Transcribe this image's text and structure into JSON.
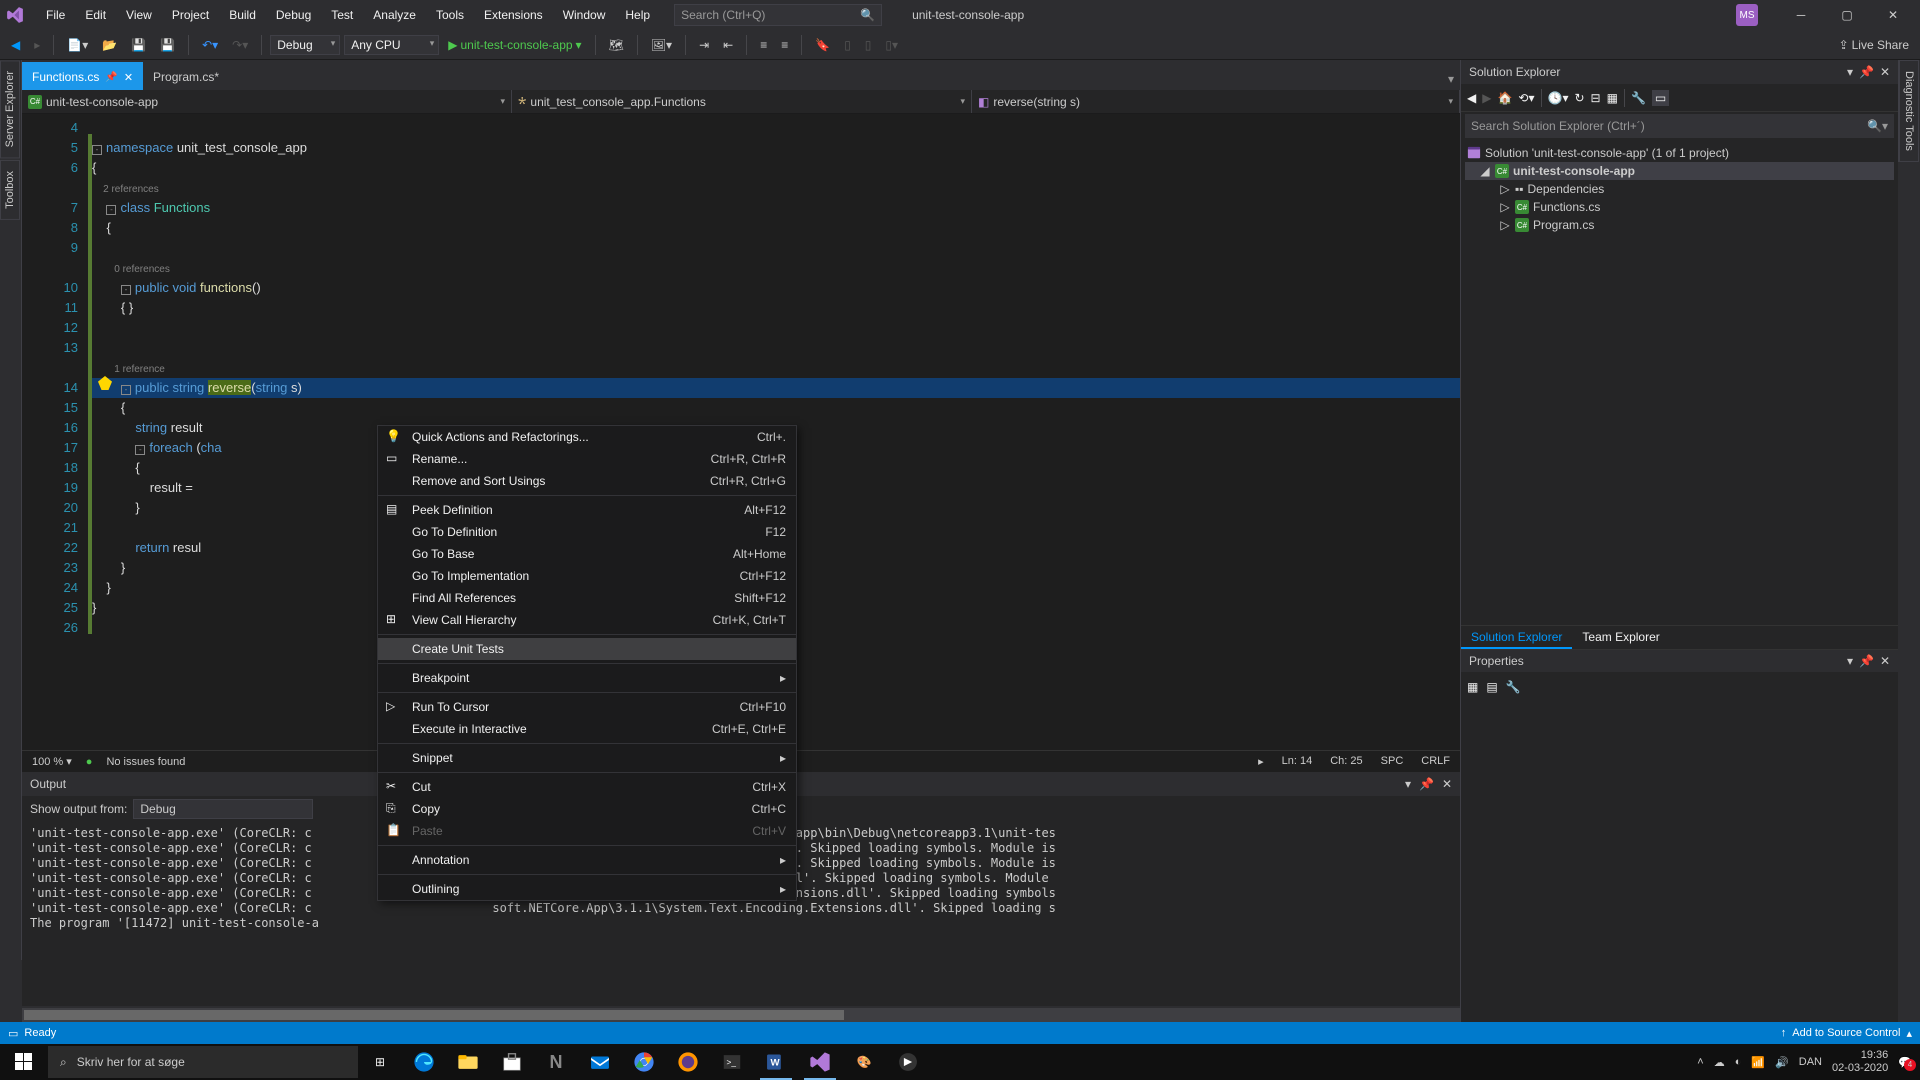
{
  "title_menu": [
    "File",
    "Edit",
    "View",
    "Project",
    "Build",
    "Debug",
    "Test",
    "Analyze",
    "Tools",
    "Extensions",
    "Window",
    "Help"
  ],
  "search_placeholder": "Search (Ctrl+Q)",
  "app_name": "unit-test-console-app",
  "avatar": "MS",
  "toolbar": {
    "config": "Debug",
    "platform": "Any CPU",
    "start": "unit-test-console-app",
    "liveshare": "Live Share"
  },
  "left_tabs": [
    "Server Explorer",
    "Toolbox"
  ],
  "right_tabs": [
    "Diagnostic Tools"
  ],
  "doc_tabs": [
    {
      "label": "Functions.cs",
      "active": true,
      "pinned": true
    },
    {
      "label": "Program.cs*",
      "active": false
    }
  ],
  "nav": {
    "project": "unit-test-console-app",
    "class": "unit_test_console_app.Functions",
    "member": "reverse(string s)"
  },
  "code": {
    "lines": [
      {
        "n": 4,
        "t": ""
      },
      {
        "n": 5,
        "t": "namespace unit_test_console_app",
        "fold": true,
        "kw": "namespace",
        "rest": " unit_test_console_app"
      },
      {
        "n": 6,
        "t": "{"
      },
      {
        "n": "",
        "t": "    2 references",
        "ref": true
      },
      {
        "n": 7,
        "t": "    class Functions",
        "fold": true,
        "kw": "    class",
        "cls": " Functions"
      },
      {
        "n": 8,
        "t": "    {"
      },
      {
        "n": 9,
        "t": ""
      },
      {
        "n": "",
        "t": "        0 references",
        "ref": true
      },
      {
        "n": 10,
        "t": "        public void functions()",
        "fold": true,
        "kw": "        public void",
        "meth": " functions",
        "rest": "()"
      },
      {
        "n": 11,
        "t": "        { }"
      },
      {
        "n": 12,
        "t": ""
      },
      {
        "n": 13,
        "t": ""
      },
      {
        "n": "",
        "t": "        1 reference",
        "ref": true
      },
      {
        "n": 14,
        "t": "        public string reverse(string s)",
        "hl": true,
        "sel": "reverse",
        "fold": true
      },
      {
        "n": 15,
        "t": "        {"
      },
      {
        "n": 16,
        "t": "            string result"
      },
      {
        "n": 17,
        "t": "            foreach (cha",
        "fold": true
      },
      {
        "n": 18,
        "t": "            {"
      },
      {
        "n": 19,
        "t": "                result ="
      },
      {
        "n": 20,
        "t": "            }"
      },
      {
        "n": 21,
        "t": ""
      },
      {
        "n": 22,
        "t": "            return resul"
      },
      {
        "n": 23,
        "t": "        }"
      },
      {
        "n": 24,
        "t": "    }"
      },
      {
        "n": 25,
        "t": "}",
        "fold": true
      },
      {
        "n": 26,
        "t": ""
      }
    ]
  },
  "context_menu": [
    {
      "label": "Quick Actions and Refactorings...",
      "sc": "Ctrl+.",
      "icon": "bulb"
    },
    {
      "label": "Rename...",
      "sc": "Ctrl+R, Ctrl+R",
      "icon": "rename"
    },
    {
      "label": "Remove and Sort Usings",
      "sc": "Ctrl+R, Ctrl+G"
    },
    {
      "sep": true
    },
    {
      "label": "Peek Definition",
      "sc": "Alt+F12",
      "icon": "peek"
    },
    {
      "label": "Go To Definition",
      "sc": "F12"
    },
    {
      "label": "Go To Base",
      "sc": "Alt+Home"
    },
    {
      "label": "Go To Implementation",
      "sc": "Ctrl+F12"
    },
    {
      "label": "Find All References",
      "sc": "Shift+F12"
    },
    {
      "label": "View Call Hierarchy",
      "sc": "Ctrl+K, Ctrl+T",
      "icon": "hier"
    },
    {
      "sep": true
    },
    {
      "label": "Create Unit Tests",
      "hover": true
    },
    {
      "sep": true
    },
    {
      "label": "Breakpoint",
      "sub": true
    },
    {
      "sep": true
    },
    {
      "label": "Run To Cursor",
      "sc": "Ctrl+F10",
      "icon": "cursor"
    },
    {
      "label": "Execute in Interactive",
      "sc": "Ctrl+E, Ctrl+E"
    },
    {
      "sep": true
    },
    {
      "label": "Snippet",
      "sub": true
    },
    {
      "sep": true
    },
    {
      "label": "Cut",
      "sc": "Ctrl+X",
      "icon": "cut"
    },
    {
      "label": "Copy",
      "sc": "Ctrl+C",
      "icon": "copy"
    },
    {
      "label": "Paste",
      "sc": "Ctrl+V",
      "icon": "paste",
      "disabled": true
    },
    {
      "sep": true
    },
    {
      "label": "Annotation",
      "sub": true
    },
    {
      "sep": true
    },
    {
      "label": "Outlining",
      "sub": true
    }
  ],
  "editor_status": {
    "zoom": "100 %",
    "issues": "No issues found",
    "ln": "Ln: 14",
    "ch": "Ch: 25",
    "spc": "SPC",
    "crlf": "CRLF"
  },
  "output": {
    "title": "Output",
    "show_from_label": "Show output from:",
    "show_from": "Debug",
    "lines": [
      "'unit-test-console-app.exe' (CoreCLR: c                         s\\unit-test-console-app\\unit-test-console-app\\bin\\Debug\\netcoreapp3.1\\unit-tes",
      "'unit-test-console-app.exe' (CoreCLR: c                         soft.NETCore.App\\3.1.1\\System.Runtime.dll'. Skipped loading symbols. Module is",
      "'unit-test-console-app.exe' (CoreCLR: c                         soft.NETCore.App\\3.1.1\\System.Console.dll'. Skipped loading symbols. Module is",
      "'unit-test-console-app.exe' (CoreCLR: c                         soft.NETCore.App\\3.1.1\\System.Threading.dll'. Skipped loading symbols. Module",
      "'unit-test-console-app.exe' (CoreCLR: c                         soft.NETCore.App\\3.1.1\\System.Runtime.Extensions.dll'. Skipped loading symbols",
      "'unit-test-console-app.exe' (CoreCLR: c                         soft.NETCore.App\\3.1.1\\System.Text.Encoding.Extensions.dll'. Skipped loading s",
      "The program '[11472] unit-test-console-a"
    ]
  },
  "statusbar": {
    "ready": "Ready",
    "src": "Add to Source Control"
  },
  "solution": {
    "title": "Solution Explorer",
    "search": "Search Solution Explorer (Ctrl+´)",
    "sln": "Solution 'unit-test-console-app' (1 of 1 project)",
    "proj": "unit-test-console-app",
    "items": [
      "Dependencies",
      "Functions.cs",
      "Program.cs"
    ],
    "tabs": [
      "Solution Explorer",
      "Team Explorer"
    ],
    "props": "Properties"
  },
  "taskbar": {
    "search": "Skriv her for at søge",
    "lang": "DAN",
    "time": "19:36",
    "date": "02-03-2020",
    "notif": "4"
  }
}
